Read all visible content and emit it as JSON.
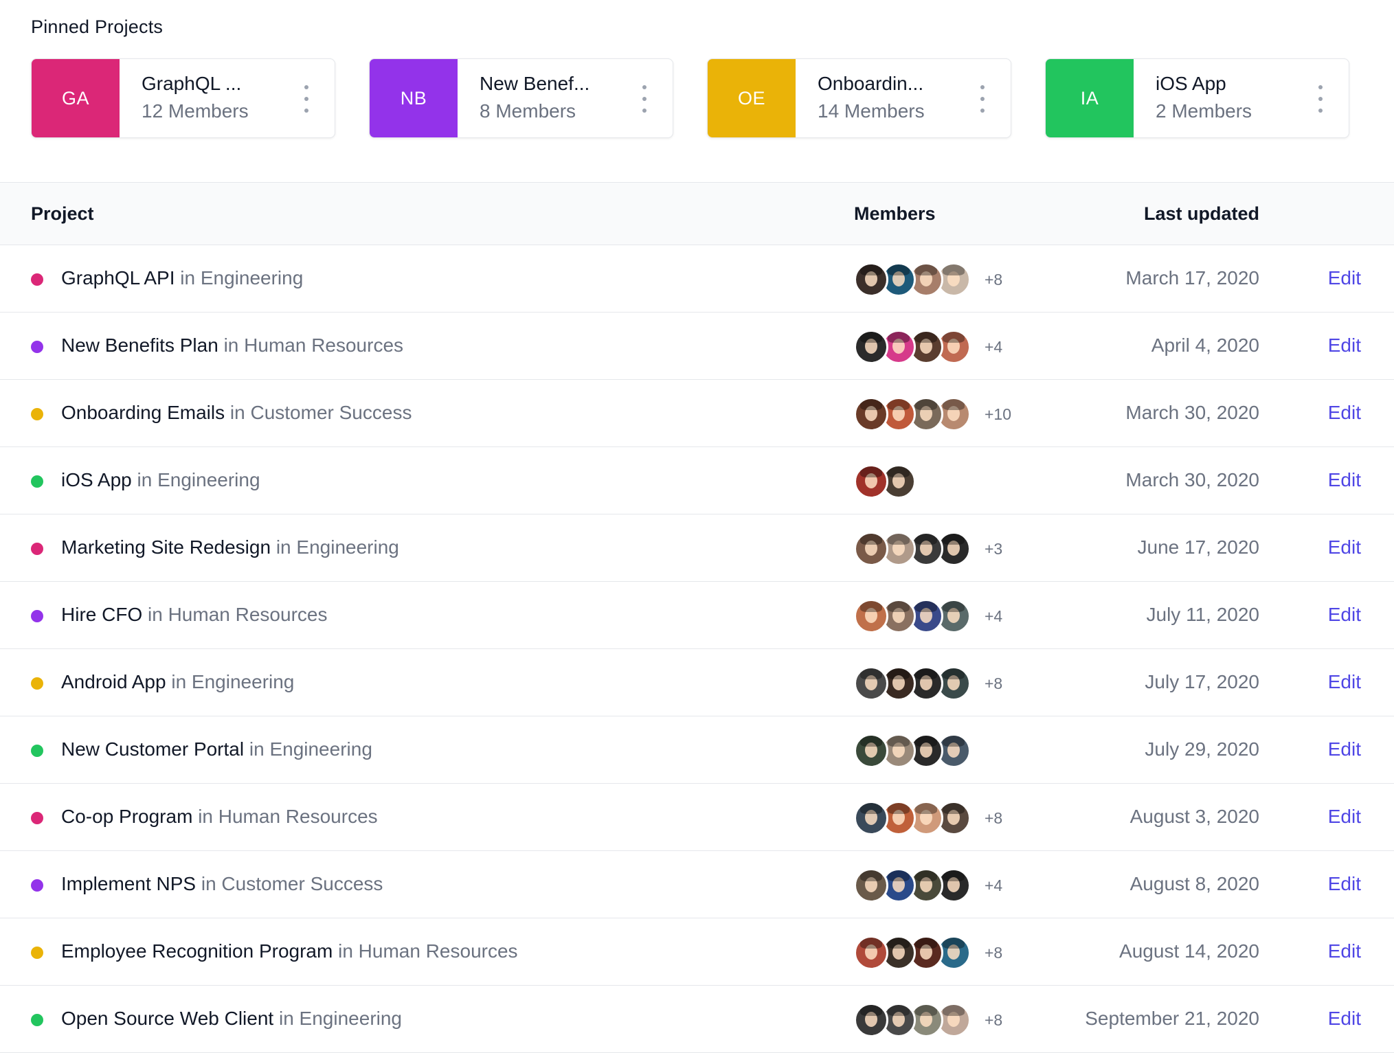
{
  "pinned": {
    "heading": "Pinned Projects",
    "cards": [
      {
        "initials": "GA",
        "title": "GraphQL ...",
        "members": "12 Members",
        "color": "#db2777"
      },
      {
        "initials": "NB",
        "title": "New Benef...",
        "members": "8 Members",
        "color": "#9333ea"
      },
      {
        "initials": "OE",
        "title": "Onboardin...",
        "members": "14 Members",
        "color": "#eab308"
      },
      {
        "initials": "IA",
        "title": "iOS App",
        "members": "2 Members",
        "color": "#22c55e"
      }
    ]
  },
  "table": {
    "headers": {
      "project": "Project",
      "members": "Members",
      "updated": "Last updated"
    },
    "edit_label": "Edit",
    "rows": [
      {
        "name": "GraphQL API",
        "team": "in Engineering",
        "dot": "#db2777",
        "more": "+8",
        "date": "March 17, 2020",
        "avatars": [
          "#3b2f2a",
          "#1e5a7a",
          "#a77e6a",
          "#c9b8a8"
        ]
      },
      {
        "name": "New Benefits Plan",
        "team": "in Human Resources",
        "dot": "#9333ea",
        "more": "+4",
        "date": "April 4, 2020",
        "avatars": [
          "#2b2b2b",
          "#d63a8a",
          "#5a3d2f",
          "#c06a52"
        ]
      },
      {
        "name": "Onboarding Emails",
        "team": "in Customer Success",
        "dot": "#eab308",
        "more": "+10",
        "date": "March 30, 2020",
        "avatars": [
          "#6a3b28",
          "#c0593a",
          "#7a6a5a",
          "#b88a70"
        ]
      },
      {
        "name": "iOS App",
        "team": "in Engineering",
        "dot": "#22c55e",
        "more": "",
        "date": "March 30, 2020",
        "avatars": [
          "#a0322a",
          "#4a3e33"
        ]
      },
      {
        "name": "Marketing Site Redesign",
        "team": "in Engineering",
        "dot": "#db2777",
        "more": "+3",
        "date": "June 17, 2020",
        "avatars": [
          "#7a5a48",
          "#b09a8a",
          "#3a3a3a",
          "#2a2a2a"
        ]
      },
      {
        "name": "Hire CFO",
        "team": "in Human Resources",
        "dot": "#9333ea",
        "more": "+4",
        "date": "July 11, 2020",
        "avatars": [
          "#c0704a",
          "#8a7060",
          "#3a4a8a",
          "#5a6a6a"
        ]
      },
      {
        "name": "Android App",
        "team": "in Engineering",
        "dot": "#eab308",
        "more": "+8",
        "date": "July 17, 2020",
        "avatars": [
          "#4a4a4a",
          "#3a2a22",
          "#2a2a2a",
          "#3a4a4a"
        ]
      },
      {
        "name": "New Customer Portal",
        "team": "in Engineering",
        "dot": "#22c55e",
        "more": "",
        "date": "July 29, 2020",
        "avatars": [
          "#3a4a3a",
          "#9a8a7a",
          "#2a2a2a",
          "#4a5a6a"
        ]
      },
      {
        "name": "Co-op Program",
        "team": "in Human Resources",
        "dot": "#db2777",
        "more": "+8",
        "date": "August 3, 2020",
        "avatars": [
          "#3a4a5a",
          "#c0603a",
          "#d09a7a",
          "#5a4a40"
        ]
      },
      {
        "name": "Implement NPS",
        "team": "in Customer Success",
        "dot": "#9333ea",
        "more": "+4",
        "date": "August 8, 2020",
        "avatars": [
          "#6a5a4a",
          "#2a4a8a",
          "#4a4a3a",
          "#2a2a2a"
        ]
      },
      {
        "name": "Employee Recognition Program",
        "team": "in Human Resources",
        "dot": "#eab308",
        "more": "+8",
        "date": "August 14, 2020",
        "avatars": [
          "#b04a3a",
          "#3a3028",
          "#5a2a20",
          "#2a6a8a"
        ]
      },
      {
        "name": "Open Source Web Client",
        "team": "in Engineering",
        "dot": "#22c55e",
        "more": "+8",
        "date": "September 21, 2020",
        "avatars": [
          "#3a3a3a",
          "#4a4a4a",
          "#8a8a7a",
          "#c0a89a"
        ]
      }
    ]
  }
}
